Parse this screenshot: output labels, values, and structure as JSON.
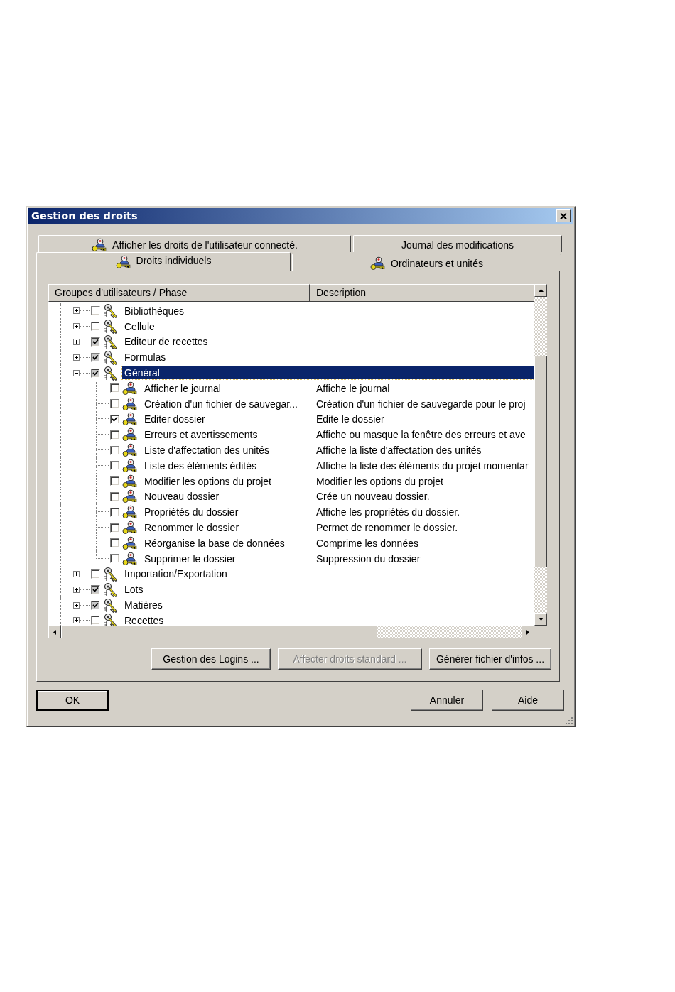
{
  "window": {
    "title": "Gestion des droits"
  },
  "tabs": [
    {
      "label": "Afficher les droits de l'utilisateur connecté.",
      "selected": false,
      "kind": "back",
      "icon": true
    },
    {
      "label": "Journal des modifications",
      "selected": false,
      "kind": "back",
      "icon": false
    },
    {
      "label": "Droits individuels",
      "selected": true,
      "kind": "front",
      "icon": true
    },
    {
      "label": "Ordinateurs et unités",
      "selected": false,
      "kind": "front",
      "icon": true
    }
  ],
  "tree": {
    "columns": [
      "Groupes d'utilisateurs / Phase",
      "Description"
    ],
    "groups": [
      {
        "label": "Bibliothèques",
        "checked": false,
        "expanded": false,
        "selected": false
      },
      {
        "label": "Cellule",
        "checked": false,
        "expanded": false,
        "selected": false
      },
      {
        "label": "Editeur de recettes",
        "checked": true,
        "expanded": false,
        "selected": false
      },
      {
        "label": "Formulas",
        "checked": true,
        "expanded": false,
        "selected": false
      },
      {
        "label": "Général",
        "checked": true,
        "expanded": true,
        "selected": true,
        "children": [
          {
            "label": "Afficher le journal",
            "description": "Affiche le journal",
            "checked": false,
            "selected": false
          },
          {
            "label": "Création d'un fichier de sauvegar...",
            "description": "Création d'un fichier de sauvegarde pour le proj",
            "checked": false,
            "selected": false
          },
          {
            "label": "Editer dossier",
            "description": "Edite le dossier",
            "checked": true,
            "selected": false
          },
          {
            "label": "Erreurs et avertissements",
            "description": "Affiche ou masque la fenêtre des erreurs et ave",
            "checked": false,
            "selected": false
          },
          {
            "label": "Liste d'affectation des unités",
            "description": "Affiche la liste d'affectation des unités",
            "checked": false,
            "selected": false
          },
          {
            "label": "Liste des éléments édités",
            "description": "Affiche la liste des éléments du projet momentar",
            "checked": false,
            "selected": false
          },
          {
            "label": "Modifier les options du projet",
            "description": "Modifier les options du projet",
            "checked": false,
            "selected": false
          },
          {
            "label": "Nouveau dossier",
            "description": "Crée un nouveau dossier.",
            "checked": false,
            "selected": false
          },
          {
            "label": "Propriétés du dossier",
            "description": "Affiche les propriétés du dossier.",
            "checked": false,
            "selected": false
          },
          {
            "label": "Renommer le dossier",
            "description": "Permet de renommer le dossier.",
            "checked": false,
            "selected": false
          },
          {
            "label": "Réorganise la base de données",
            "description": "Comprime les données",
            "checked": false,
            "selected": false
          },
          {
            "label": "Supprimer le dossier",
            "description": "Suppression du dossier",
            "checked": false,
            "selected": false
          }
        ]
      },
      {
        "label": "Importation/Exportation",
        "checked": false,
        "expanded": false,
        "selected": false
      },
      {
        "label": "Lots",
        "checked": true,
        "expanded": false,
        "selected": false
      },
      {
        "label": "Matières",
        "checked": true,
        "expanded": false,
        "selected": false
      },
      {
        "label": "Recettes",
        "checked": false,
        "expanded": false,
        "selected": false
      }
    ]
  },
  "panel_buttons": [
    {
      "label": "Gestion des Logins ...",
      "disabled": false
    },
    {
      "label": "Affecter droits standard ...",
      "disabled": true
    },
    {
      "label": "Générer fichier d'infos ...",
      "disabled": false
    }
  ],
  "dialog_buttons": [
    {
      "label": "OK",
      "kind": "default"
    },
    {
      "label": "Annuler",
      "kind": "normal"
    },
    {
      "label": "Aide",
      "kind": "normal"
    }
  ]
}
